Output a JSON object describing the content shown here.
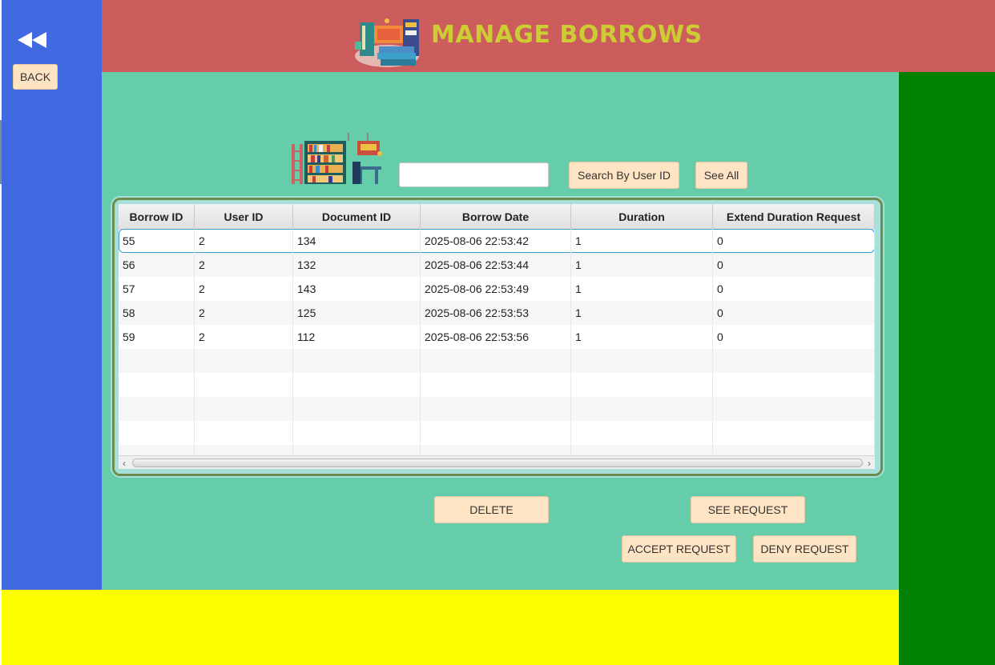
{
  "header": {
    "title": "MANAGE BORROWS"
  },
  "sidebar": {
    "back_label": "BACK"
  },
  "search": {
    "placeholder": "",
    "search_button": "Search By User ID",
    "see_all_button": "See All"
  },
  "table": {
    "columns": [
      "Borrow ID",
      "User ID",
      "Document ID",
      "Borrow Date",
      "Duration",
      "Extend Duration Request"
    ],
    "rows": [
      [
        "55",
        "2",
        "134",
        "2025-08-06 22:53:42",
        "1",
        "0"
      ],
      [
        "56",
        "2",
        "132",
        "2025-08-06 22:53:44",
        "1",
        "0"
      ],
      [
        "57",
        "2",
        "143",
        "2025-08-06 22:53:49",
        "1",
        "0"
      ],
      [
        "58",
        "2",
        "125",
        "2025-08-06 22:53:53",
        "1",
        "0"
      ],
      [
        "59",
        "2",
        "112",
        "2025-08-06 22:53:56",
        "1",
        "0"
      ]
    ]
  },
  "actions": {
    "delete": "DELETE",
    "see_request": "SEE REQUEST",
    "accept_request": "ACCEPT REQUEST",
    "deny_request": "DENY REQUEST"
  },
  "colors": {
    "sidebar": "#4169e1",
    "header": "#cd5c5c",
    "main": "#66cdaa",
    "right_panel": "#008000",
    "bottom_panel": "#ffff00",
    "title": "#cccc33",
    "button": "#ffe4c4"
  },
  "icons": {
    "back": "rewind-icon",
    "logo": "library-books-icon",
    "shelf": "bookshelf-icon"
  }
}
